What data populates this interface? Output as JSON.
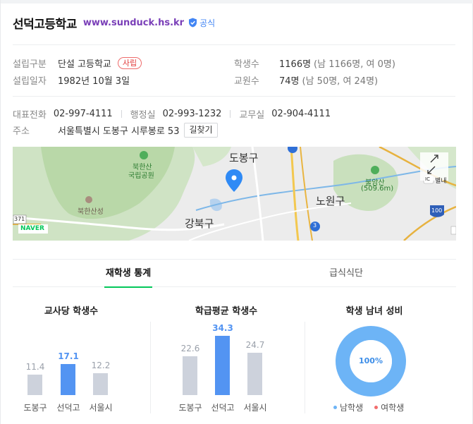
{
  "header": {
    "school_name": "선덕고등학교",
    "site_url": "www.sunduck.hs.kr",
    "verified_label": "공식"
  },
  "info": {
    "type_label": "설립구분",
    "type_value": "단설 고등학교",
    "type_tag": "사립",
    "founded_label": "설립일자",
    "founded_value": "1982년 10월 3일",
    "students_label": "학생수",
    "students_value": "1166명",
    "students_detail": "(남 1166명, 여 0명)",
    "teachers_label": "교원수",
    "teachers_value": "74명",
    "teachers_detail": "(남 50명, 여 24명)"
  },
  "contact": {
    "main_label": "대표전화",
    "main_value": "02-997-4111",
    "admin_label": "행정실",
    "admin_value": "02-993-1232",
    "office_label": "교무실",
    "office_value": "02-904-4111",
    "address_label": "주소",
    "address_value": "서울특별시 도봉구 시루봉로 53",
    "route_button": "길찾기"
  },
  "map": {
    "labels": {
      "dobong": "도봉구",
      "nowon": "노원구",
      "gangbuk": "강북구",
      "bukhansan_park_1": "북한산",
      "bukhansan_park_2": "국립공원",
      "bukhan_fortress": "북한산성",
      "bulamsan": "불암산",
      "bulamsan_height": "(509.6m)",
      "byeollae": "별내",
      "ic": "IC",
      "route_371": "371",
      "route_3": "3",
      "route_100": "100",
      "provider": "NAVER"
    }
  },
  "tabs": [
    {
      "label": "재학생 통계"
    },
    {
      "label": "급식식단"
    }
  ],
  "colors": {
    "school_bar": "#5394f2",
    "other_bar": "#cdd2dc",
    "male": "#6db4f6",
    "female": "#f26d6d",
    "accent": "#03c75a"
  },
  "chart_data": [
    {
      "type": "bar",
      "title": "교사당 학생수",
      "categories": [
        "도봉구",
        "선덕고",
        "서울시"
      ],
      "values": [
        11.4,
        17.1,
        12.2
      ],
      "value_labels": [
        "11.4",
        "17.1",
        "12.2"
      ],
      "highlight_index": 1
    },
    {
      "type": "bar",
      "title": "학급평균 학생수",
      "categories": [
        "도봉구",
        "선덕고",
        "서울시"
      ],
      "values": [
        22.6,
        34.3,
        24.7
      ],
      "value_labels": [
        "22.6",
        "34.3",
        "24.7"
      ],
      "highlight_index": 1
    },
    {
      "type": "pie",
      "title": "학생 남녀 성비",
      "categories": [
        "남학생",
        "여학생"
      ],
      "values": [
        100,
        0
      ],
      "center_label": "100%"
    }
  ]
}
